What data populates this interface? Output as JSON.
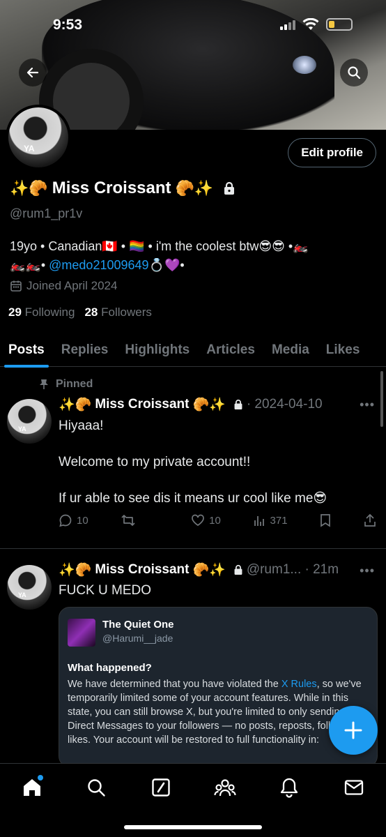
{
  "status": {
    "time": "9:53"
  },
  "profile": {
    "display_name": "Miss Croissant",
    "emoji_before": "✨🥐",
    "emoji_after": "🥐✨",
    "handle": "@rum1_pr1v",
    "edit_label": "Edit profile",
    "avatar_text": "YA",
    "bio_line1": "19yo • Canadian🇨🇦 • 🏳️‍🌈 • i'm the coolest btw😎😎 •🏍️",
    "bio_line2_prefix": "🏍️🏍️• ",
    "bio_mention": "@medo21009649",
    "bio_line2_suffix": "💍💜•",
    "joined": "Joined April 2024",
    "following_count": "29",
    "following_label": "Following",
    "followers_count": "28",
    "followers_label": "Followers"
  },
  "tabs": [
    "Posts",
    "Replies",
    "Highlights",
    "Articles",
    "Media",
    "Likes"
  ],
  "posts": [
    {
      "pinned_label": "Pinned",
      "name": "Miss Croissant",
      "meta": "· 2024-04-10",
      "text": "Hiyaaa!\n\nWelcome to my private account!!\n\nIf ur able to see dis it means ur cool like me😎",
      "replies": "10",
      "likes": "10",
      "views": "371"
    },
    {
      "name": "Miss Croissant",
      "meta": "@rum1... · 21m",
      "text": "FUCK U MEDO",
      "quote": {
        "name": "The Quiet One",
        "handle": "@Harumi__jade",
        "title": "What happened?",
        "body_pre": "We have determined that you have violated the ",
        "body_link": "X Rules",
        "body_post": ", so we've temporarily limited some of your account features. While in this state, you can still browse X, but you're limited to only sending Direct Messages to your followers — no posts, reposts, follows, or likes. Your account will be restored to full functionality in:"
      }
    }
  ],
  "colors": {
    "accent": "#1d9bf0",
    "background": "#000000",
    "muted": "#71767b"
  }
}
